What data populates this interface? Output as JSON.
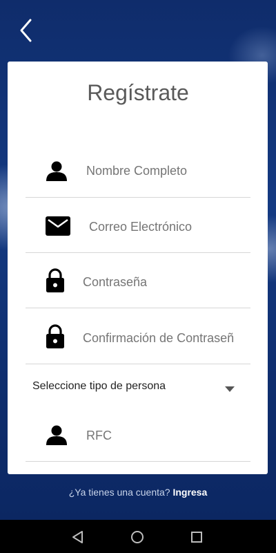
{
  "header": {
    "back_icon": "chevron-left-icon"
  },
  "form": {
    "title": "Regístrate",
    "fields": [
      {
        "placeholder": "Nombre Completo",
        "icon": "person-icon"
      },
      {
        "placeholder": "Correo Electrónico",
        "icon": "mail-icon"
      },
      {
        "placeholder": "Contraseña",
        "icon": "lock-icon"
      },
      {
        "placeholder": "Confirmación de Contraseñ",
        "icon": "lock-icon"
      }
    ],
    "person_type_select": {
      "selected": "Seleccione tipo de persona",
      "icon": "caret-down-icon"
    },
    "rfc": {
      "placeholder": "RFC",
      "icon": "person-icon"
    }
  },
  "footer": {
    "question": "¿Ya tienes una cuenta?",
    "link": "Ingresa"
  },
  "navbar": {
    "buttons": [
      "back-triangle-icon",
      "home-circle-icon",
      "recents-square-icon"
    ]
  },
  "colors": {
    "background": "#0f2c6b",
    "card": "#ffffff",
    "icon": "#000000",
    "placeholder": "#757575"
  }
}
